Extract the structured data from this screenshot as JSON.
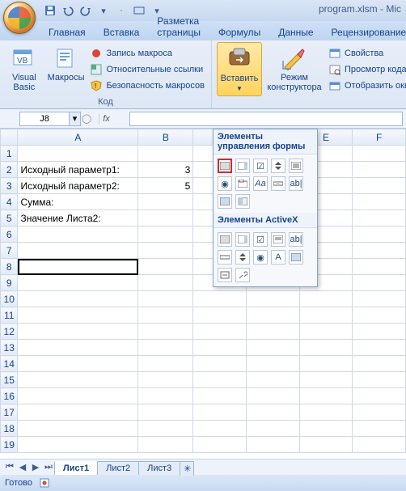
{
  "title": "program.xlsm - Mic",
  "qat": {
    "tips": [
      "save",
      "undo",
      "redo",
      "quickprint",
      "email"
    ]
  },
  "tabs": [
    "Главная",
    "Вставка",
    "Разметка страницы",
    "Формулы",
    "Данные",
    "Рецензирование"
  ],
  "ribbon": {
    "group_code": {
      "label": "Код",
      "vb": "Visual\nBasic",
      "macros": "Макросы",
      "record": "Запись макроса",
      "relref": "Относительные ссылки",
      "security": "Безопасность макросов"
    },
    "group_controls": {
      "insert": "Вставить",
      "design": "Режим\nконструктора",
      "props": "Свойства",
      "viewcode": "Просмотр кода",
      "showdlg": "Отобразить окн"
    }
  },
  "namebox": "J8",
  "fx_label": "fx",
  "columns": [
    "A",
    "B",
    "C",
    "D",
    "E",
    "F"
  ],
  "rows": [
    "1",
    "2",
    "3",
    "4",
    "5",
    "6",
    "7",
    "8",
    "9",
    "10",
    "11",
    "12",
    "13",
    "14",
    "15",
    "16",
    "17",
    "18",
    "19"
  ],
  "cells": {
    "A2": "Исходный параметр1:",
    "B2": "3",
    "A3": "Исходный параметр2:",
    "B3": "5",
    "A4": "Сумма:",
    "A5": "Значение Листа2:"
  },
  "active_row": "8",
  "sheets": [
    "Лист1",
    "Лист2",
    "Лист3"
  ],
  "active_sheet": 0,
  "status": "Готово",
  "dropdown": {
    "head_form": "Элементы управления формы",
    "head_activex": "Элементы ActiveX",
    "form_items": [
      "button",
      "combo",
      "check",
      "spin",
      "list",
      "option",
      "group",
      "label",
      "edit",
      "scroll",
      "image",
      "toggle"
    ],
    "ax_items": [
      "button",
      "combo",
      "check",
      "list",
      "text",
      "scroll",
      "spin",
      "option",
      "label",
      "image",
      "more",
      "tools"
    ]
  }
}
